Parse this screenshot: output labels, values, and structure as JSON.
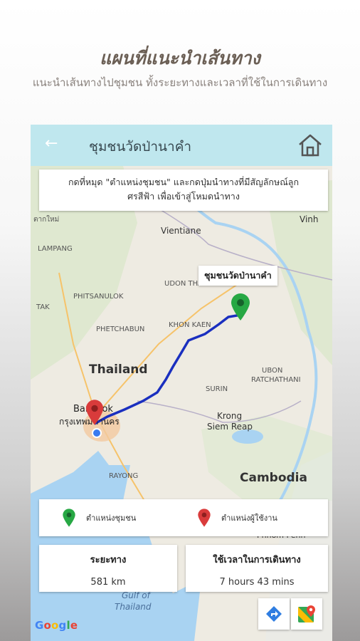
{
  "promo": {
    "title": "แผนที่แนะนำเส้นทาง",
    "subtitle": "แนะนำเส้นทางไปชุมชน ทั้งระยะทางและเวลาที่ใช้ในการเดินทาง"
  },
  "appbar": {
    "back_icon": "←",
    "title": "ชุมชนวัดป่านาคำ",
    "home_icon": "home-icon"
  },
  "hint": {
    "line1": "กดที่หมุด \"ตำแหน่งชุมชน\" และกดปุ่มนำทางที่มีสัญลักษณ์ลูก",
    "line2": "ศรสีฟ้า เพื่อเข้าสู่โหมดนำทาง"
  },
  "map": {
    "destination_label": "ชุมชนวัดป่านาคำ",
    "labels": {
      "vientiane": "Vientiane",
      "vinh": "Vinh",
      "lampang": "LAMPANG",
      "udon": "UDON THANI",
      "tak": "TAK",
      "phitsanulok": "PHITSANULOK",
      "khonkaen": "KHON KAEN",
      "phetchabun": "PHETCHABUN",
      "thailand": "Thailand",
      "ubon1": "UBON",
      "ubon2": "RATCHATHANI",
      "surin": "SURIN",
      "bangkok": "Bangkok",
      "bangkok_th": "กรุงเทพมหานคร",
      "krong1": "Krong",
      "krong2": "Siem Reap",
      "cambodia": "Cambodia",
      "rayong": "RAYONG",
      "phnom": "Phnom Penh",
      "gulf1": "Gulf of",
      "gulf2": "Thailand",
      "maesot": "ตากใหม่"
    },
    "colors": {
      "route": "#1a2fbf",
      "destination_pin": "#27a844",
      "user_pin": "#d93b3b",
      "water": "#a9d3f2",
      "land": "#efece4"
    }
  },
  "legend": {
    "community": "ตำแหน่งชุมชน",
    "user": "ตำแหน่งผู้ใช้งาน"
  },
  "distance": {
    "label": "ระยะทาง",
    "value": "581 km"
  },
  "duration": {
    "label": "ใช้เวลาในการเดินทาง",
    "value": "7 hours 43 mins"
  },
  "attribution": {
    "g1": "G",
    "o1": "o",
    "o2": "o",
    "g2": "g",
    "l": "l",
    "e": "e"
  },
  "buttons": {
    "directions_icon": "directions-icon",
    "maps_icon": "google-maps-icon"
  }
}
